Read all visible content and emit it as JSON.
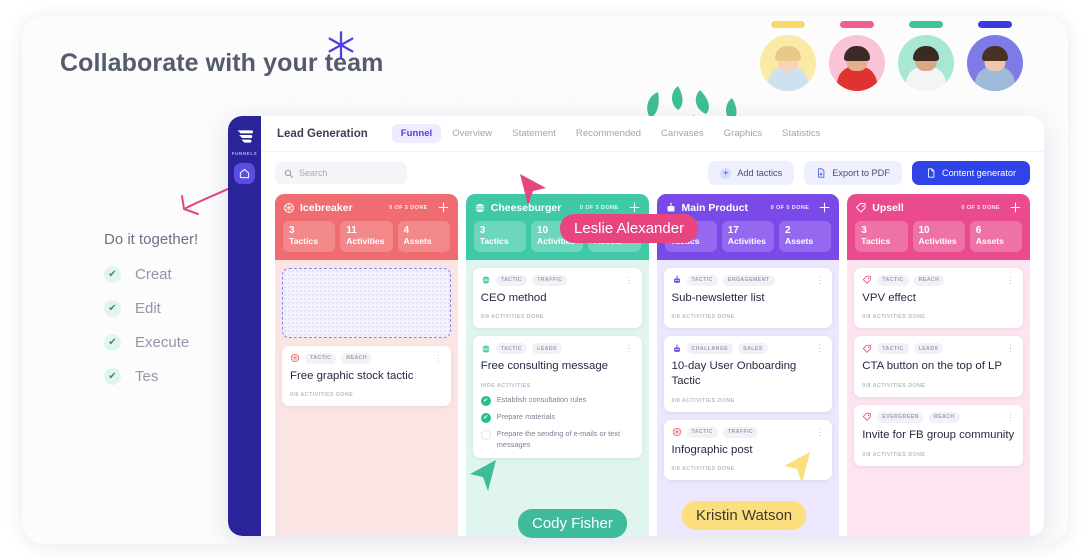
{
  "page": {
    "headline": "Collaborate with your team",
    "sparkle_icon": "sparkle-icon"
  },
  "avatars": [
    {
      "name": "avatar-1",
      "bar_color": "#f7d96a",
      "bg": "#fbeaa6",
      "hair": "#e8c98a",
      "skin": "#f6d3bb",
      "body": "#cfe0ef"
    },
    {
      "name": "avatar-2",
      "bar_color": "#ef5f96",
      "bg": "#f9c3d8",
      "hair": "#3a2b26",
      "skin": "#e2b08d",
      "body": "#e0322f"
    },
    {
      "name": "avatar-3",
      "bar_color": "#3fc39b",
      "bg": "#a8e8d2",
      "hair": "#3b2a21",
      "skin": "#d8a883",
      "body": "#f3f4f6"
    },
    {
      "name": "avatar-4",
      "bar_color": "#3b3ce0",
      "bg": "#7f7be6",
      "hair": "#4a3126",
      "skin": "#edc6ad",
      "body": "#9fb9d8"
    }
  ],
  "checklist": {
    "title": "Do it together!",
    "items": [
      {
        "label": "Creat",
        "checked": true
      },
      {
        "label": "Edit",
        "checked": true
      },
      {
        "label": "Execute",
        "checked": true
      },
      {
        "label": "Tes",
        "checked": true
      }
    ],
    "check_glyph": "✔"
  },
  "rail": {
    "logo_icon": "funnel-logo-icon",
    "label": "FUNNELS",
    "home_icon": "home-icon"
  },
  "header": {
    "brand": "Lead Generation",
    "tabs": [
      {
        "label": "Funnel",
        "active": true
      },
      {
        "label": "Overview",
        "active": false
      },
      {
        "label": "Statement",
        "active": false
      },
      {
        "label": "Recommended",
        "active": false
      },
      {
        "label": "Canvases",
        "active": false
      },
      {
        "label": "Graphics",
        "active": false
      },
      {
        "label": "Statistics",
        "active": false
      }
    ]
  },
  "toolbar": {
    "search_placeholder": "Search",
    "search_value": "",
    "search_icon": "search-icon",
    "add_tactics_label": "Add tactics",
    "add_tactics_icon": "plus-icon",
    "export_label": "Export to PDF",
    "export_icon": "document-export-icon",
    "generator_label": "Content generator",
    "generator_icon": "document-icon",
    "primary_color": "#2f43e8"
  },
  "board": {
    "columns": [
      {
        "name": "Icebreaker",
        "icon": "snowflake-icon",
        "done_label": "0 OF 5 DONE",
        "add_icon": "plus-icon",
        "header_color": "#ef6c70",
        "stat_color": "#f3888b",
        "body_color": "#fbe5e4",
        "stats": [
          {
            "n": "3",
            "t": "Tactics"
          },
          {
            "n": "11",
            "t": "Activities"
          },
          {
            "n": "4",
            "t": "Assets"
          }
        ],
        "dropzone": true,
        "cards": [
          {
            "icon": "snowflake-icon",
            "icon_color": "#ef6c70",
            "chips": [
              "TACTIC",
              "REACH"
            ],
            "title": "Free graphic stock tactic",
            "footer": "0/8 ACTIVITIES DONE",
            "activities": []
          }
        ]
      },
      {
        "name": "Cheeseburger",
        "icon": "burger-icon",
        "done_label": "0 OF 5 DONE",
        "add_icon": "plus-icon",
        "header_color": "#3fc9a6",
        "stat_color": "#6ed6bc",
        "body_color": "#dff5ee",
        "stats": [
          {
            "n": "3",
            "t": "Tactics"
          },
          {
            "n": "10",
            "t": "Activities"
          },
          {
            "n": "5",
            "t": "Assets"
          }
        ],
        "dropzone": false,
        "cards": [
          {
            "icon": "burger-icon",
            "icon_color": "#3fc9a6",
            "chips": [
              "TACTIC",
              "TRAFFIC"
            ],
            "title": "CEO method",
            "footer": "0/8 ACTIVITIES DONE",
            "activities": []
          },
          {
            "icon": "burger-icon",
            "icon_color": "#3fc9a6",
            "chips": [
              "TACTIC",
              "LEADS"
            ],
            "title": "Free consulting message",
            "footer": "HIDE ACTIVITIES",
            "activities": [
              {
                "text": "Establish consultation rules",
                "done": true
              },
              {
                "text": "Prepare materials",
                "done": true
              },
              {
                "text": "Prepare the sending of e-mails or text messages",
                "done": false
              }
            ]
          }
        ]
      },
      {
        "name": "Main Product",
        "icon": "robot-icon",
        "done_label": "0 OF 5 DONE",
        "add_icon": "plus-icon",
        "header_color": "#7a4ae8",
        "stat_color": "#9468ef",
        "body_color": "#ece7fd",
        "stats": [
          {
            "n": "3",
            "t": "Tactics"
          },
          {
            "n": "17",
            "t": "Activities"
          },
          {
            "n": "2",
            "t": "Assets"
          }
        ],
        "dropzone": false,
        "cards": [
          {
            "icon": "robot-icon",
            "icon_color": "#7a4ae8",
            "chips": [
              "TACTIC",
              "ENGAGEMENT"
            ],
            "title": "Sub-newsletter list",
            "footer": "0/8 ACTIVITIES DONE",
            "activities": []
          },
          {
            "icon": "robot-icon",
            "icon_color": "#7a4ae8",
            "chips": [
              "CHALLANGE",
              "SALES"
            ],
            "title": "10-day User Onboarding Tactic",
            "footer": "0/8 ACTIVITIES DONE",
            "activities": []
          },
          {
            "icon": "snowflake-icon",
            "icon_color": "#ef6c70",
            "chips": [
              "TACTIC",
              "TRAFFIC"
            ],
            "title": "Infographic post",
            "footer": "0/8 ACTIVITIES DONE",
            "activities": []
          }
        ]
      },
      {
        "name": "Upsell",
        "icon": "tag-icon",
        "done_label": "0 OF 5 DONE",
        "add_icon": "plus-icon",
        "header_color": "#ea4a8e",
        "stat_color": "#ef72a7",
        "body_color": "#fde4f0",
        "stats": [
          {
            "n": "3",
            "t": "Tactics"
          },
          {
            "n": "10",
            "t": "Activities"
          },
          {
            "n": "6",
            "t": "Assets"
          }
        ],
        "dropzone": false,
        "cards": [
          {
            "icon": "tag-icon",
            "icon_color": "#ea4a8e",
            "chips": [
              "TACTIC",
              "REACH"
            ],
            "title": "VPV effect",
            "footer": "0/8 ACTIVITIES DONE",
            "activities": []
          },
          {
            "icon": "tag-icon",
            "icon_color": "#ea4a8e",
            "chips": [
              "TACTIC",
              "LEADS"
            ],
            "title": "CTA button on the top of LP",
            "footer": "0/8 ACTIVITIES DONE",
            "activities": []
          },
          {
            "icon": "tag-icon",
            "icon_color": "#ea4a8e",
            "chips": [
              "EVERGREEN",
              "REACH"
            ],
            "title": "Invite for FB group community",
            "footer": "0/8 ACTIVITIES DONE",
            "activities": []
          }
        ]
      }
    ]
  },
  "collaborators": [
    {
      "name": "Leslie Alexander",
      "color": "#e8447f"
    },
    {
      "name": "Cody Fisher",
      "color": "#3ebb9a"
    },
    {
      "name": "Kristin Watson",
      "color": "#fbdf7e"
    }
  ]
}
